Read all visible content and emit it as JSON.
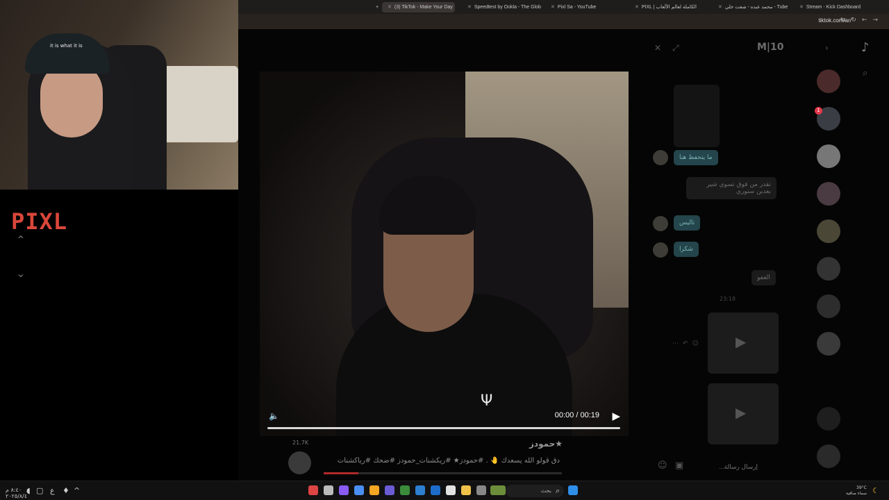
{
  "webcam": {
    "cap_text": "it is what it is"
  },
  "overlay_brand": "PIXL",
  "tabs": [
    {
      "label": "(3) TikTok - Make Your Day",
      "active": true
    },
    {
      "label": "Speedtest by Ookla - The Glob"
    },
    {
      "label": "Pixl Sa - YouTube"
    },
    {
      "label": "PIXL | الكاملة لعالم الألعاب"
    },
    {
      "label": "محمد عبده - شفت خلي - Tube"
    },
    {
      "label": "Stream - Kick Dashboard"
    }
  ],
  "address": {
    "url": "tiktok.com/ar/"
  },
  "video": {
    "time": "00:00 / 00:19",
    "progress": 0
  },
  "post": {
    "author": "حمودز★",
    "likes": "21.7K",
    "caption": "دق قولو الله يسعدك 🤚 . #حمودز★ #ريكشنات_حمودز #ضحك #رياكشنات"
  },
  "chat": {
    "header": "M|10",
    "messages": [
      {
        "text": "ما يتحفظ هنا",
        "style": "teal"
      },
      {
        "text": "تقدر من فوق تسوي شير بعدين ستوري",
        "style": "gray"
      },
      {
        "text": "تاليس",
        "style": "teal"
      },
      {
        "text": "شكرا",
        "style": "teal"
      },
      {
        "text": "العفو",
        "style": "gray"
      }
    ],
    "timestamp": "23:18",
    "input_placeholder": "إرسال رسالة..."
  },
  "taskbar": {
    "search_placeholder": "بحث",
    "weather_temp": "39°C",
    "weather_desc": "سماء صافية",
    "clock_time": "٨:٤٠ م",
    "clock_date": "٢٠٢٥/٨/٤",
    "lang": "ع"
  }
}
